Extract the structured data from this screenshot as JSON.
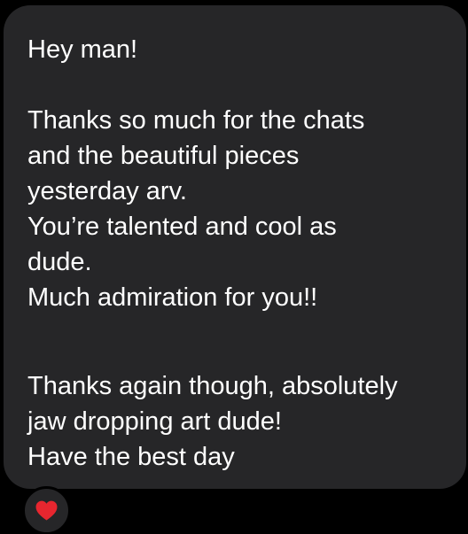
{
  "message": {
    "lines": [
      "Hey man!",
      "Thanks so much for the chats",
      "and the beautiful pieces",
      "yesterday arv.",
      "You’re talented and cool as",
      "dude.",
      "Much admiration for you!!",
      "Thanks again though, absolutely",
      "jaw dropping art dude!",
      "Have the best day"
    ]
  },
  "reaction": {
    "icon": "red-heart-icon",
    "color": "#e8262f"
  },
  "colors": {
    "background": "#000000",
    "bubble": "#262628",
    "text": "#ffffff"
  }
}
